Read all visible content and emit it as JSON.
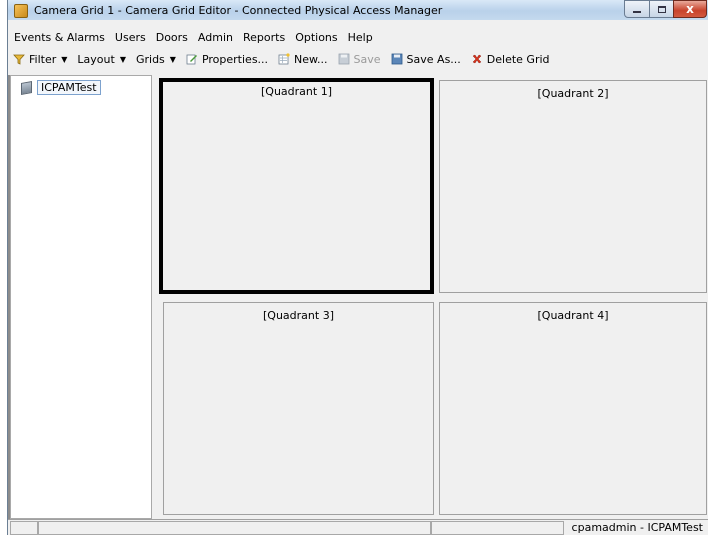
{
  "window": {
    "title": "Camera Grid 1 - Camera Grid Editor - Connected Physical Access Manager",
    "controls": {
      "minimize": "minimize",
      "maximize": "maximize",
      "close": "x"
    }
  },
  "menubar": {
    "items": [
      "Events & Alarms",
      "Users",
      "Doors",
      "Admin",
      "Reports",
      "Options",
      "Help"
    ]
  },
  "toolbar": {
    "filter_label": "Filter",
    "layout_label": "Layout",
    "grids_label": "Grids",
    "properties_label": "Properties...",
    "new_label": "New...",
    "save_label": "Save",
    "save_as_label": "Save As...",
    "delete_grid_label": "Delete Grid"
  },
  "tree": {
    "root_label": "ICPAMTest"
  },
  "grid": {
    "quadrants": [
      "[Quadrant 1]",
      "[Quadrant 2]",
      "[Quadrant 3]",
      "[Quadrant 4]"
    ],
    "selected_quadrant": 1
  },
  "status": {
    "user_text": "cpamadmin - ICPAMTest"
  },
  "colors": {
    "title_bar": "#c4d9ee",
    "close_button": "#c8432c",
    "selected_border": "#000000",
    "panel_background": "#f0f0f0"
  }
}
